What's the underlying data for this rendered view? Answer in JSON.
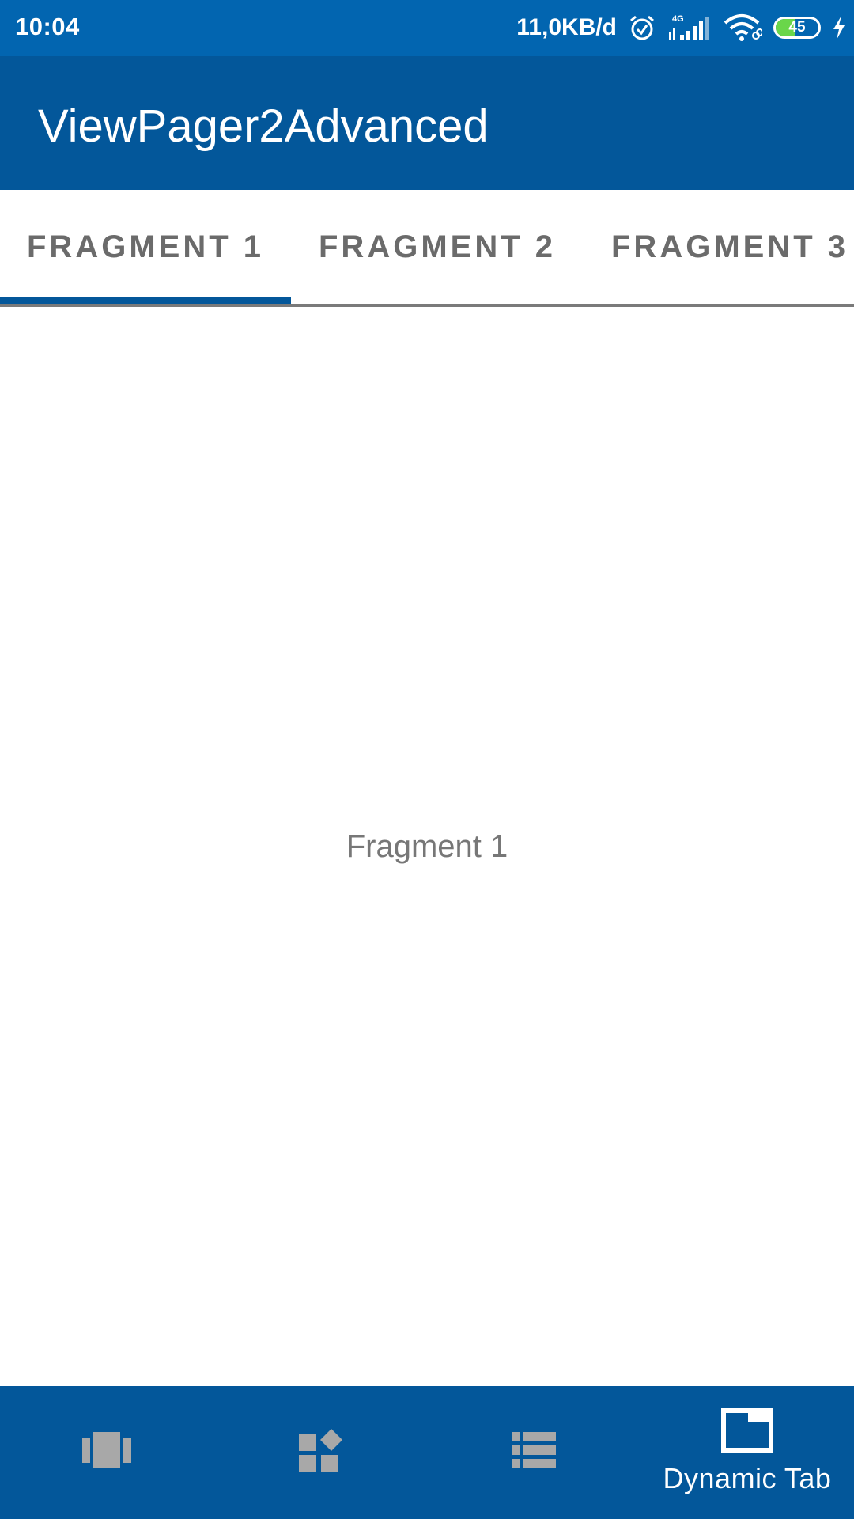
{
  "status_bar": {
    "time": "10:04",
    "net_speed": "11,0KB/d",
    "network_type": "4G",
    "battery_level": "45",
    "battery_fraction": 0.45,
    "icons": [
      "alarm-icon",
      "signal-icon",
      "wifi-icon",
      "battery-icon",
      "charging-icon"
    ]
  },
  "app_bar": {
    "title": "ViewPager2Advanced"
  },
  "tabs": [
    {
      "label": "FRAGMENT 1",
      "selected": true
    },
    {
      "label": "FRAGMENT 2",
      "selected": false
    },
    {
      "label": "FRAGMENT 3",
      "selected": false
    }
  ],
  "content": {
    "text": "Fragment 1"
  },
  "bottom_nav": {
    "items": [
      {
        "icon": "carousel-icon",
        "label": "",
        "selected": false
      },
      {
        "icon": "widgets-icon",
        "label": "",
        "selected": false
      },
      {
        "icon": "list-icon",
        "label": "",
        "selected": false
      },
      {
        "icon": "tab-icon",
        "label": "Dynamic Tab",
        "selected": true
      }
    ]
  },
  "colors": {
    "status_bar": "#0265b0",
    "primary": "#03579a",
    "tab_inactive": "#6b6b6b",
    "nav_inactive_icon": "#a8a8a8",
    "nav_active": "#ffffff",
    "fragment_text": "#777777"
  }
}
